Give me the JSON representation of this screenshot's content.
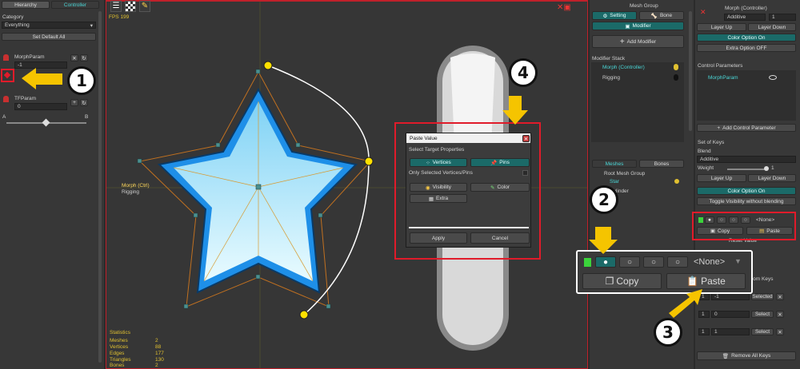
{
  "hierarchy": {
    "tab_hierarchy": "Hierarchy",
    "tab_controller": "Controller",
    "category_label": "Category",
    "category_value": "Everything",
    "set_default_all": "Set Default All",
    "param1_name": "MorphParam",
    "param1_value": "-1",
    "param2_name": "TFParam",
    "param2_value": "0",
    "slider_a": "A",
    "slider_b": "B"
  },
  "viewport": {
    "fps": "FPS 199",
    "morph_label": "Morph (Ctrl)",
    "rigging_label": "Rigging",
    "stats": {
      "title": "Statistics",
      "rows": [
        {
          "k": "Meshes",
          "v": "2"
        },
        {
          "k": "Vertices",
          "v": "88"
        },
        {
          "k": "Edges",
          "v": "177"
        },
        {
          "k": "Triangles",
          "v": "130"
        },
        {
          "k": "Bones",
          "v": "2"
        }
      ]
    }
  },
  "paste_dialog": {
    "title": "Paste Value",
    "select_props": "Select Target Properties",
    "vertices": "Vertices",
    "pins": "Pins",
    "only_selected": "Only Selected Vertices/Pins",
    "visibility": "Visibility",
    "color": "Color",
    "extra": "Extra",
    "apply": "Apply",
    "cancel": "Cancel"
  },
  "mesh_panel": {
    "mesh_group": "Mesh Group",
    "setting": "Setting",
    "bone": "Bone",
    "modifier": "Modifier",
    "add_modifier": "Add Modifier",
    "modifier_stack": "Modifier Stack",
    "mod1": "Morph (Controller)",
    "mod2": "Rigging",
    "tab_meshes": "Meshes",
    "tab_bones": "Bones",
    "root_mesh_group": "Root Mesh Group",
    "star": "Star",
    "cylinder": "Cylinder"
  },
  "right_panel": {
    "title": "Morph (Controller)",
    "blend_value": "Additive",
    "layer_num": "1",
    "layer_up": "Layer Up",
    "layer_down": "Layer Down",
    "color_option": "Color Option On",
    "extra_option": "Extra Option OFF",
    "control_params": "Control Parameters",
    "morph_param": "MorphParam",
    "add_control_param": "Add Control Parameter",
    "set_of_keys": "Set of Keys",
    "blend_label": "Blend",
    "blend_value2": "Additive",
    "weight_label": "Weight",
    "weight_value": "1",
    "layer_up2": "Layer Up",
    "layer_down2": "Layer Down",
    "color_option2": "Color Option On",
    "toggle_visibility": "Toggle Visibility without blending",
    "none_small": "<None>",
    "copy_small": "Copy",
    "paste_small": "Paste",
    "reset_value": "Reset Value",
    "from_keys": "rom Keys",
    "key_rows": [
      {
        "a": "1",
        "b": "-1",
        "btn": "Selected"
      },
      {
        "a": "1",
        "b": "0",
        "btn": "Select"
      },
      {
        "a": "1",
        "b": "1",
        "btn": "Select"
      }
    ],
    "remove_all_keys": "Remove All Keys"
  },
  "zoom_box": {
    "none": "<None>",
    "copy": "Copy",
    "paste": "Paste"
  },
  "badges": {
    "b1": "1",
    "b2": "2",
    "b3": "3",
    "b4": "4"
  },
  "colors": {
    "teal": "#1b6a68",
    "highlight_red": "#e01b2a",
    "callout_yellow": "#f5c400",
    "star_blue": "#1e8fe8",
    "star_fill": "#bfeaff"
  }
}
